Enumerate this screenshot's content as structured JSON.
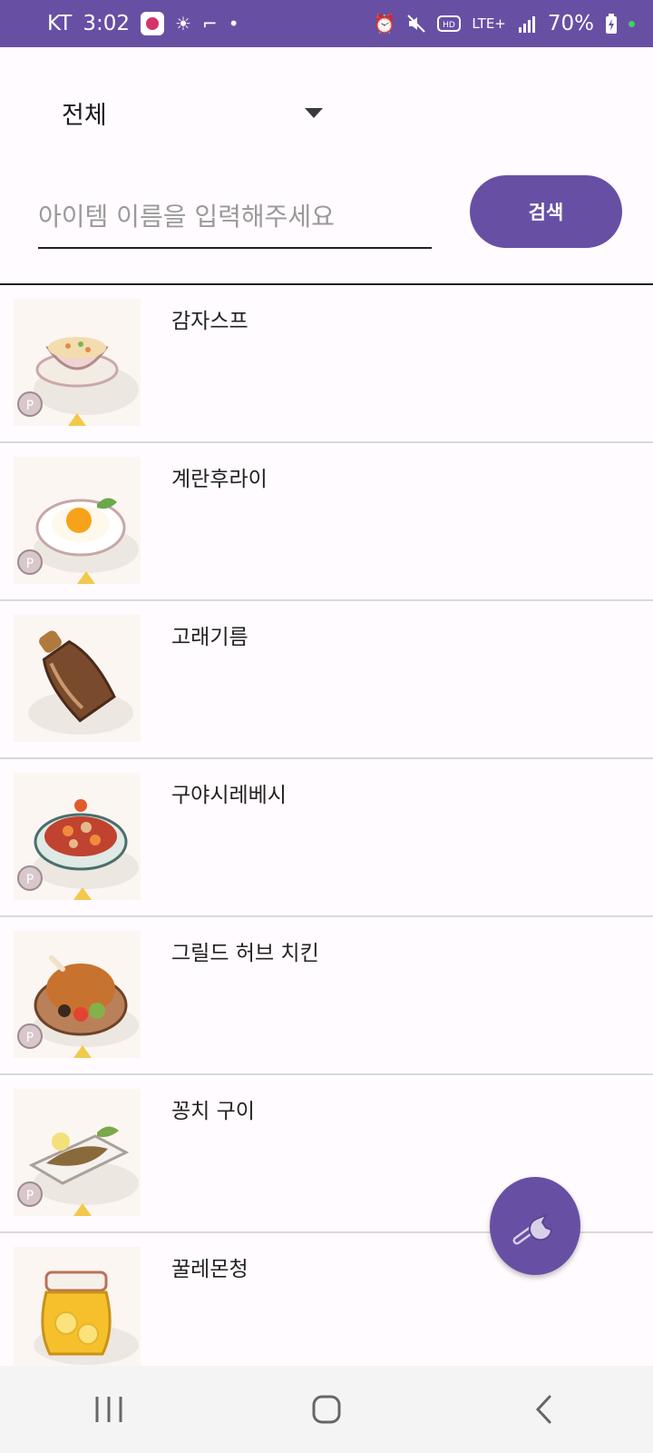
{
  "status_bar": {
    "carrier": "KT",
    "time": "3:02",
    "network": "LTE+",
    "battery": "70%"
  },
  "filter": {
    "category_value": "전체"
  },
  "search": {
    "placeholder": "아이템 이름을 입력해주세요",
    "value": "",
    "button_label": "검색"
  },
  "items": [
    {
      "name": "감자스프",
      "icon": "potato-soup-icon"
    },
    {
      "name": "계란후라이",
      "icon": "fried-egg-icon"
    },
    {
      "name": "고래기름",
      "icon": "whale-oil-bottle-icon"
    },
    {
      "name": "구야시레베시",
      "icon": "stew-dish-icon"
    },
    {
      "name": "그릴드 허브 치킨",
      "icon": "roast-chicken-icon"
    },
    {
      "name": "꽁치 구이",
      "icon": "grilled-fish-icon"
    },
    {
      "name": "꿀레몬청",
      "icon": "honey-lemon-jar-icon"
    }
  ],
  "fab": {
    "icon": "wrench-icon"
  },
  "nav_bar": {
    "recents": "recents-icon",
    "home": "home-icon",
    "back": "back-icon"
  },
  "colors": {
    "primary": "#6750a4",
    "background": "#fffbfe"
  }
}
